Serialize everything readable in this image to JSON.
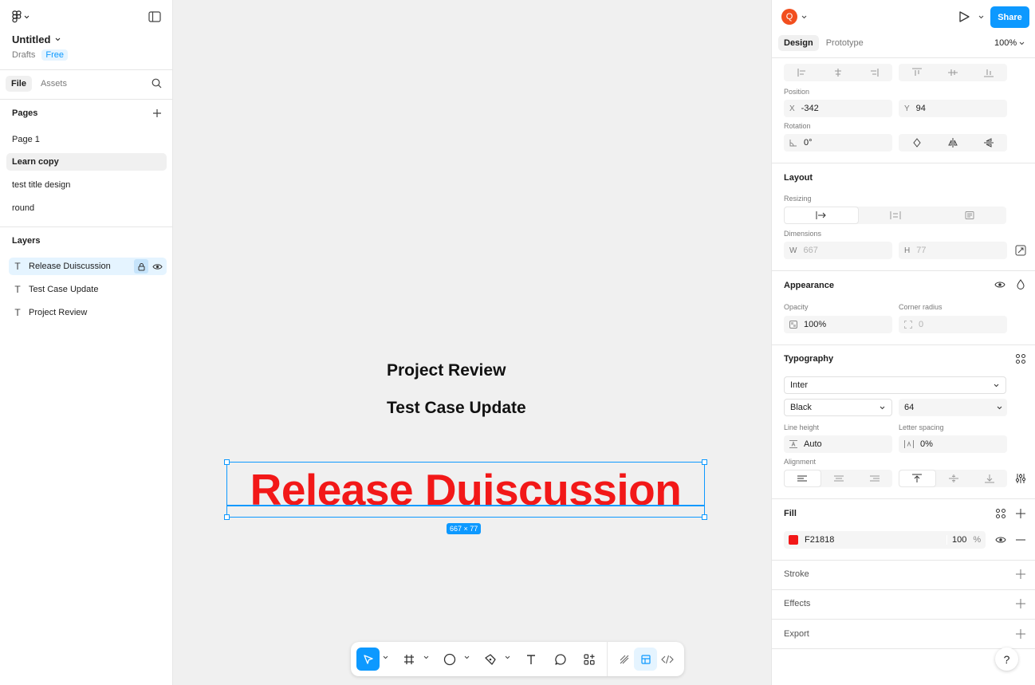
{
  "file": {
    "title": "Untitled",
    "location": "Drafts",
    "plan": "Free"
  },
  "left_tabs": [
    "File",
    "Assets"
  ],
  "pages": {
    "heading": "Pages",
    "items": [
      "Page 1",
      "Learn copy",
      "test  title design",
      "round"
    ]
  },
  "layers": {
    "heading": "Layers",
    "items": [
      "Release Duiscussion",
      "Test Case Update",
      "Project Review"
    ]
  },
  "canvas": {
    "texts": [
      "Project Review",
      "Test Case Update"
    ],
    "selected_text": "Release Duiscussion",
    "dimension_badge": "667 × 77"
  },
  "header": {
    "avatar_initial": "Q",
    "share": "Share",
    "zoom": "100%"
  },
  "right_tabs": [
    "Design",
    "Prototype"
  ],
  "design": {
    "position_label": "Position",
    "x_label": "X",
    "x_value": "-342",
    "y_label": "Y",
    "y_value": "94",
    "rotation_label": "Rotation",
    "rotation_value": "0°",
    "layout_title": "Layout",
    "resizing_label": "Resizing",
    "dimensions_label": "Dimensions",
    "w_label": "W",
    "w_value": "667",
    "h_label": "H",
    "h_value": "77",
    "appearance_title": "Appearance",
    "opacity_label": "Opacity",
    "opacity_value": "100%",
    "corner_label": "Corner radius",
    "corner_value": "0",
    "typography_title": "Typography",
    "font_family": "Inter",
    "font_weight": "Black",
    "font_size": "64",
    "line_height_label": "Line height",
    "line_height_value": "Auto",
    "letter_spacing_label": "Letter spacing",
    "letter_spacing_value": "0%",
    "alignment_label": "Alignment",
    "fill_title": "Fill",
    "fill_hex": "F21818",
    "fill_opacity": "100",
    "fill_pct": "%",
    "stroke_title": "Stroke",
    "effects_title": "Effects",
    "export_title": "Export"
  },
  "colors": {
    "accent": "#0d99ff",
    "fill": "#f21818",
    "avatar": "#f24e1e"
  },
  "help": "?"
}
